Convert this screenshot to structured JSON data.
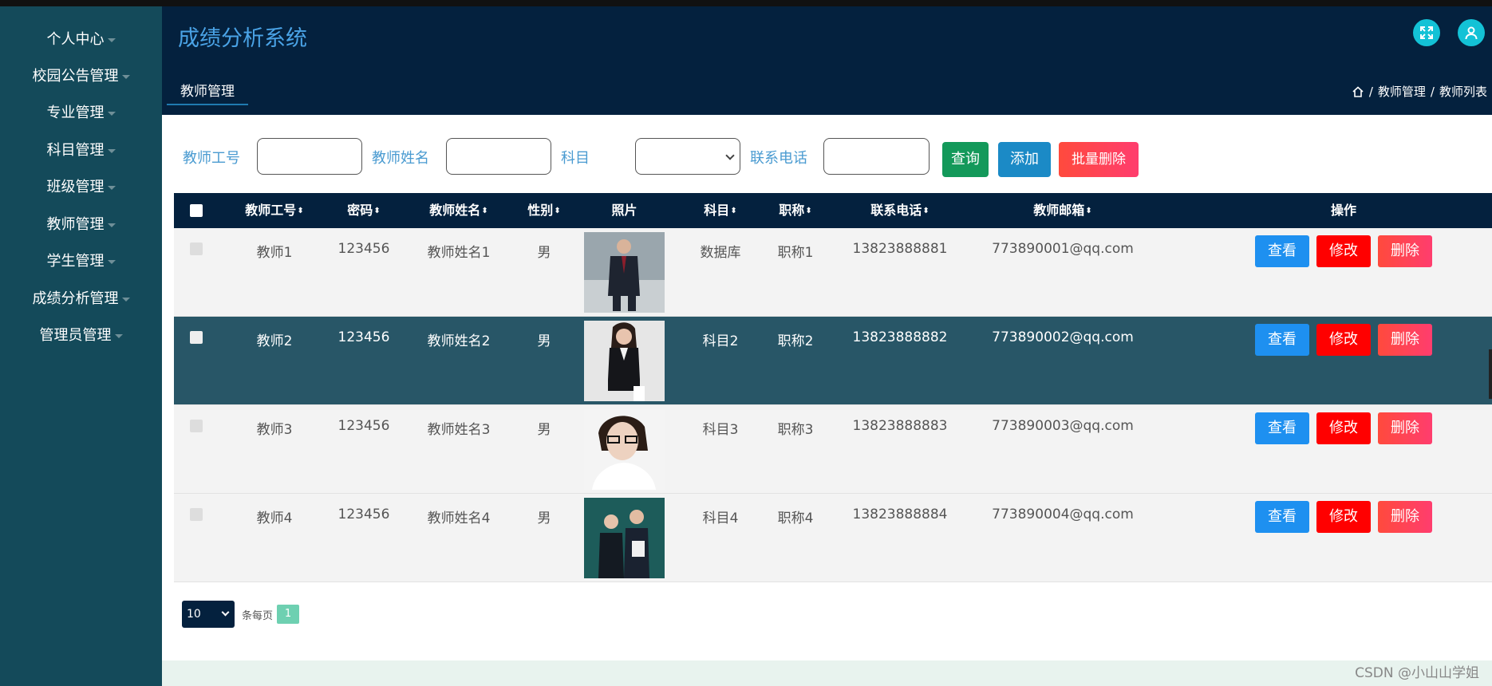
{
  "sidebar": {
    "items": [
      {
        "label": "个人中心"
      },
      {
        "label": "校园公告管理"
      },
      {
        "label": "专业管理"
      },
      {
        "label": "科目管理"
      },
      {
        "label": "班级管理"
      },
      {
        "label": "教师管理"
      },
      {
        "label": "学生管理"
      },
      {
        "label": "成绩分析管理"
      },
      {
        "label": "管理员管理"
      }
    ]
  },
  "header": {
    "title": "成绩分析系统",
    "active_tab": "教师管理",
    "breadcrumb": [
      "教师管理",
      "教师列表"
    ],
    "colors": {
      "bg": "#04213e",
      "title": "#4aa3e6",
      "icon_button": "#13c2d6"
    }
  },
  "filters": {
    "teacher_id_label": "教师工号",
    "teacher_name_label": "教师姓名",
    "subject_label": "科目",
    "phone_label": "联系电话",
    "query_button": "查询",
    "add_button": "添加",
    "batch_delete_button": "批量删除"
  },
  "table": {
    "headers": [
      "教师工号",
      "密码",
      "教师姓名",
      "性别",
      "照片",
      "科目",
      "职称",
      "联系电话",
      "教师邮箱",
      "操作"
    ],
    "rows": [
      {
        "id": "教师1",
        "password": "123456",
        "name": "教师姓名1",
        "gender": "男",
        "subject": "数据库",
        "title": "职称1",
        "phone": "13823888881",
        "email": "773890001@qq.com"
      },
      {
        "id": "教师2",
        "password": "123456",
        "name": "教师姓名2",
        "gender": "男",
        "subject": "科目2",
        "title": "职称2",
        "phone": "13823888882",
        "email": "773890002@qq.com"
      },
      {
        "id": "教师3",
        "password": "123456",
        "name": "教师姓名3",
        "gender": "男",
        "subject": "科目3",
        "title": "职称3",
        "phone": "13823888883",
        "email": "773890003@qq.com"
      },
      {
        "id": "教师4",
        "password": "123456",
        "name": "教师姓名4",
        "gender": "男",
        "subject": "科目4",
        "title": "职称4",
        "phone": "13823888884",
        "email": "773890004@qq.com"
      }
    ],
    "actions": {
      "view": "查看",
      "edit": "修改",
      "delete": "删除"
    }
  },
  "pagination": {
    "page_size": "10",
    "per_page_text": "条每页",
    "current_page": "1"
  },
  "watermark": "CSDN @小山山学姐"
}
